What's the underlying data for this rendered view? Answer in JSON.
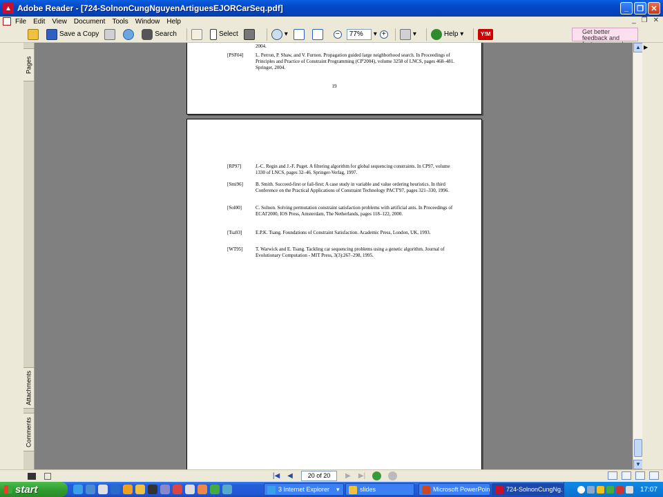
{
  "window": {
    "title": "Adobe Reader - [724-SolnonCungNguyenArtiguesEJORCarSeq.pdf]",
    "app_icon": "adobe-reader-icon"
  },
  "menu": {
    "items": [
      "File",
      "Edit",
      "View",
      "Document",
      "Tools",
      "Window",
      "Help"
    ]
  },
  "toolbar": {
    "save_copy_label": "Save a Copy",
    "search_label": "Search",
    "select_label": "Select",
    "zoom_value": "77%",
    "help_label": "Help",
    "ym_label": "Y!M",
    "feedback_text": "Get better feedback and faster approvals"
  },
  "nav_tabs": {
    "pages": "Pages",
    "attachments": "Attachments",
    "comments": "Comments"
  },
  "page_top": {
    "carryover": "2004.",
    "refs": [
      {
        "key": "[PSF04]",
        "text": "L. Perron, P. Shaw, and V. Furnon. Propagation guided large neighborhood search. In Proceedings of Principles and Practice of Constraint Programming (CP'2004), volume 3258 of LNCS, pages 468–481. Springer, 2004."
      }
    ],
    "page_number": "19"
  },
  "page_current": {
    "refs": [
      {
        "key": "[RP97]",
        "text": "J.-C. Regin and J.-F. Puget. A filtering algorithm for global sequencing constraints. In CP97, volume 1330 of LNCS, pages 32–46. Springer-Verlag, 1997."
      },
      {
        "key": "[Smi96]",
        "text": "B. Smith. Succeed-first or fail-first: A case study in variable and value ordering heuristics. In third Conference on the Practical Applications of Constraint Technology PACT'97, pages 321–330, 1996."
      },
      {
        "key": "[Sol00]",
        "text": "C. Solnon. Solving permutation constraint satisfaction problems with artificial ants. In Proceedings of ECAI'2000, IOS Press, Amsterdam, The Netherlands, pages 118–122, 2000."
      },
      {
        "key": "[Tsa93]",
        "text": "E.P.K. Tsang. Foundations of Constraint Satisfaction. Academic Press, London, UK, 1993."
      },
      {
        "key": "[WT95]",
        "text": "T. Warwick and E. Tsang. Tackling car sequencing problems using a genetic algorithm. Journal of Evolutionary Computation - MIT Press, 3(3):267–298, 1995."
      }
    ]
  },
  "status": {
    "page_indicator": "20 of 20"
  },
  "taskbar": {
    "start_label": "start",
    "items": [
      {
        "label": "3 Internet Explorer",
        "icon": "ie-icon",
        "color": "#3aa0e8"
      },
      {
        "label": "slides",
        "icon": "folder-icon",
        "color": "#f0c040"
      },
      {
        "label": "Microsoft PowerPoin...",
        "icon": "powerpoint-icon",
        "color": "#d04820"
      },
      {
        "label": "724-SolnonCungNg...",
        "icon": "adobe-reader-icon",
        "color": "#c8102e"
      }
    ],
    "clock": "17:07"
  },
  "colors": {
    "titlebar": "#0348c8",
    "doc_background": "#808080",
    "taskbar": "#245edb",
    "start": "#2e9a2e"
  }
}
